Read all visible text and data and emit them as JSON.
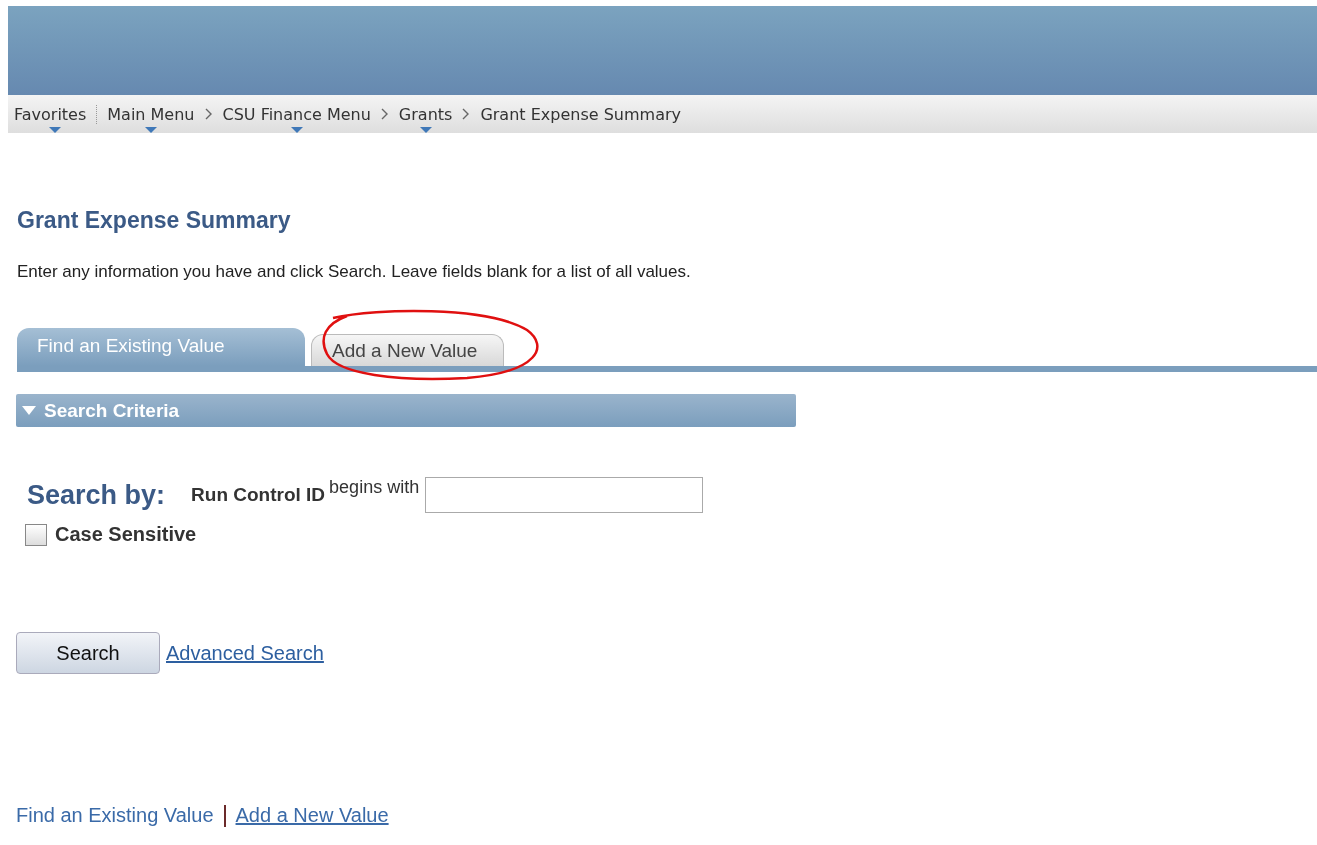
{
  "breadcrumbs": [
    {
      "label": "Favorites"
    },
    {
      "label": "Main Menu"
    },
    {
      "label": "CSU Finance Menu"
    },
    {
      "label": "Grants"
    }
  ],
  "current_page": "Grant Expense Summary",
  "page_title": "Grant Expense Summary",
  "instructions": "Enter any information you have and click Search. Leave fields blank for a list of all values.",
  "tabs": [
    {
      "label": "Find an Existing Value",
      "selected": true
    },
    {
      "label": "Add a New Value",
      "selected": false,
      "circled": true
    }
  ],
  "section": {
    "title": "Search Criteria",
    "expanded": true
  },
  "search_by": {
    "label": "Search by:",
    "field_label": "Run Control ID",
    "operator": "begins with"
  },
  "case_sensitive": {
    "label": "Case Sensitive",
    "checked": false
  },
  "buttons": [
    {
      "label": "Search",
      "kind": "button"
    },
    {
      "label": "Advanced Search",
      "kind": "link"
    }
  ],
  "footer_links": [
    {
      "label": "Find an Existing Value",
      "underlined": false
    },
    {
      "label": "Add a New Value",
      "underlined": true
    }
  ]
}
